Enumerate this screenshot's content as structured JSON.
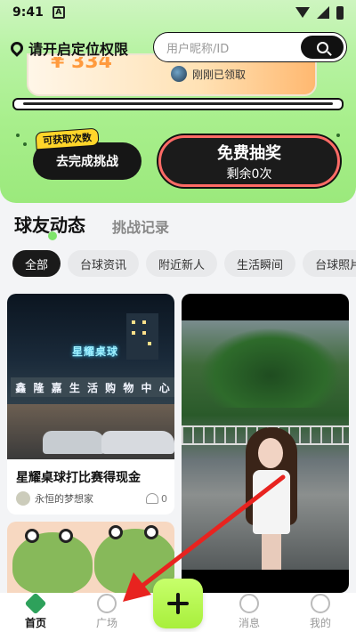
{
  "status_bar": {
    "time": "9:41",
    "notif_icon": "a-box-icon"
  },
  "header": {
    "location_label": "请开启定位权限",
    "search_placeholder": "用户昵称/ID"
  },
  "promo": {
    "prize_partial": "¥ 334",
    "claim_text": "刚刚已领取",
    "tag_label": "可获取次数",
    "challenge_button": "去完成挑战",
    "lottery_title": "免费抽奖",
    "lottery_remaining": "剩余0次",
    "accent_red": "#ff6b66",
    "green": "#a8ef8c"
  },
  "sections": {
    "active": "球友动态",
    "other": "挑战记录"
  },
  "chips": [
    "全部",
    "台球资讯",
    "附近新人",
    "生活瞬间",
    "台球照片"
  ],
  "feed": {
    "post1": {
      "sign_top": "星耀桌球",
      "sign_bottom": "鑫 隆 嘉 生 活 购 物 中 心",
      "title": "星耀桌球打比赛得现金",
      "author": "永恒的梦想家",
      "likes": "0"
    }
  },
  "nav": {
    "home": "首页",
    "square": "广场",
    "messages": "消息",
    "me": "我的"
  }
}
